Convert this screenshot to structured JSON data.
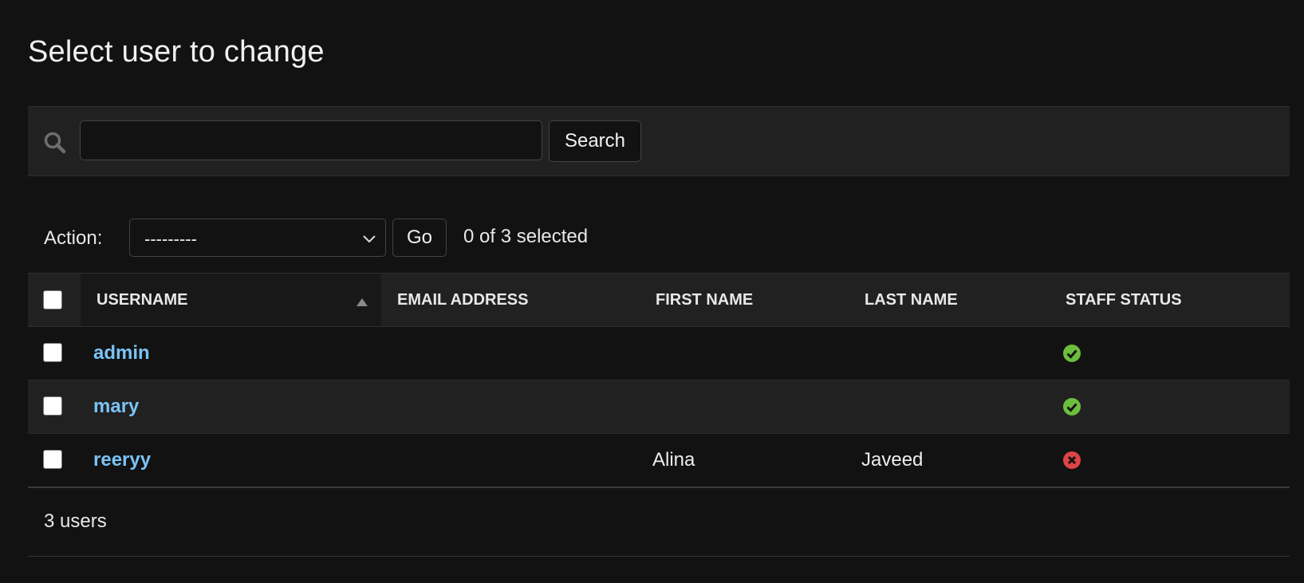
{
  "page": {
    "title": "Select user to change"
  },
  "search": {
    "value": "",
    "button_label": "Search"
  },
  "actions": {
    "label": "Action:",
    "selected_option": "---------",
    "go_label": "Go",
    "selection_counter": "0 of 3 selected"
  },
  "table": {
    "columns": [
      "USERNAME",
      "EMAIL ADDRESS",
      "FIRST NAME",
      "LAST NAME",
      "STAFF STATUS"
    ],
    "sorted_column": "USERNAME",
    "sort_direction": "ascending",
    "rows": [
      {
        "username": "admin",
        "email": "",
        "first_name": "",
        "last_name": "",
        "staff_status": true
      },
      {
        "username": "mary",
        "email": "",
        "first_name": "",
        "last_name": "",
        "staff_status": true
      },
      {
        "username": "reeryy",
        "email": "",
        "first_name": "Alina",
        "last_name": "Javeed",
        "staff_status": false
      }
    ]
  },
  "footer": {
    "count_text": "3 users"
  },
  "colors": {
    "background": "#121212",
    "link": "#79c3f5",
    "status_true": "#6cbf3c",
    "status_false": "#dd4444"
  },
  "icons": {
    "search": "search-icon",
    "select": "chevron-down-icon",
    "sort": "sort-asc-icon",
    "status_true": "check-circle-icon",
    "status_false": "x-circle-icon"
  }
}
